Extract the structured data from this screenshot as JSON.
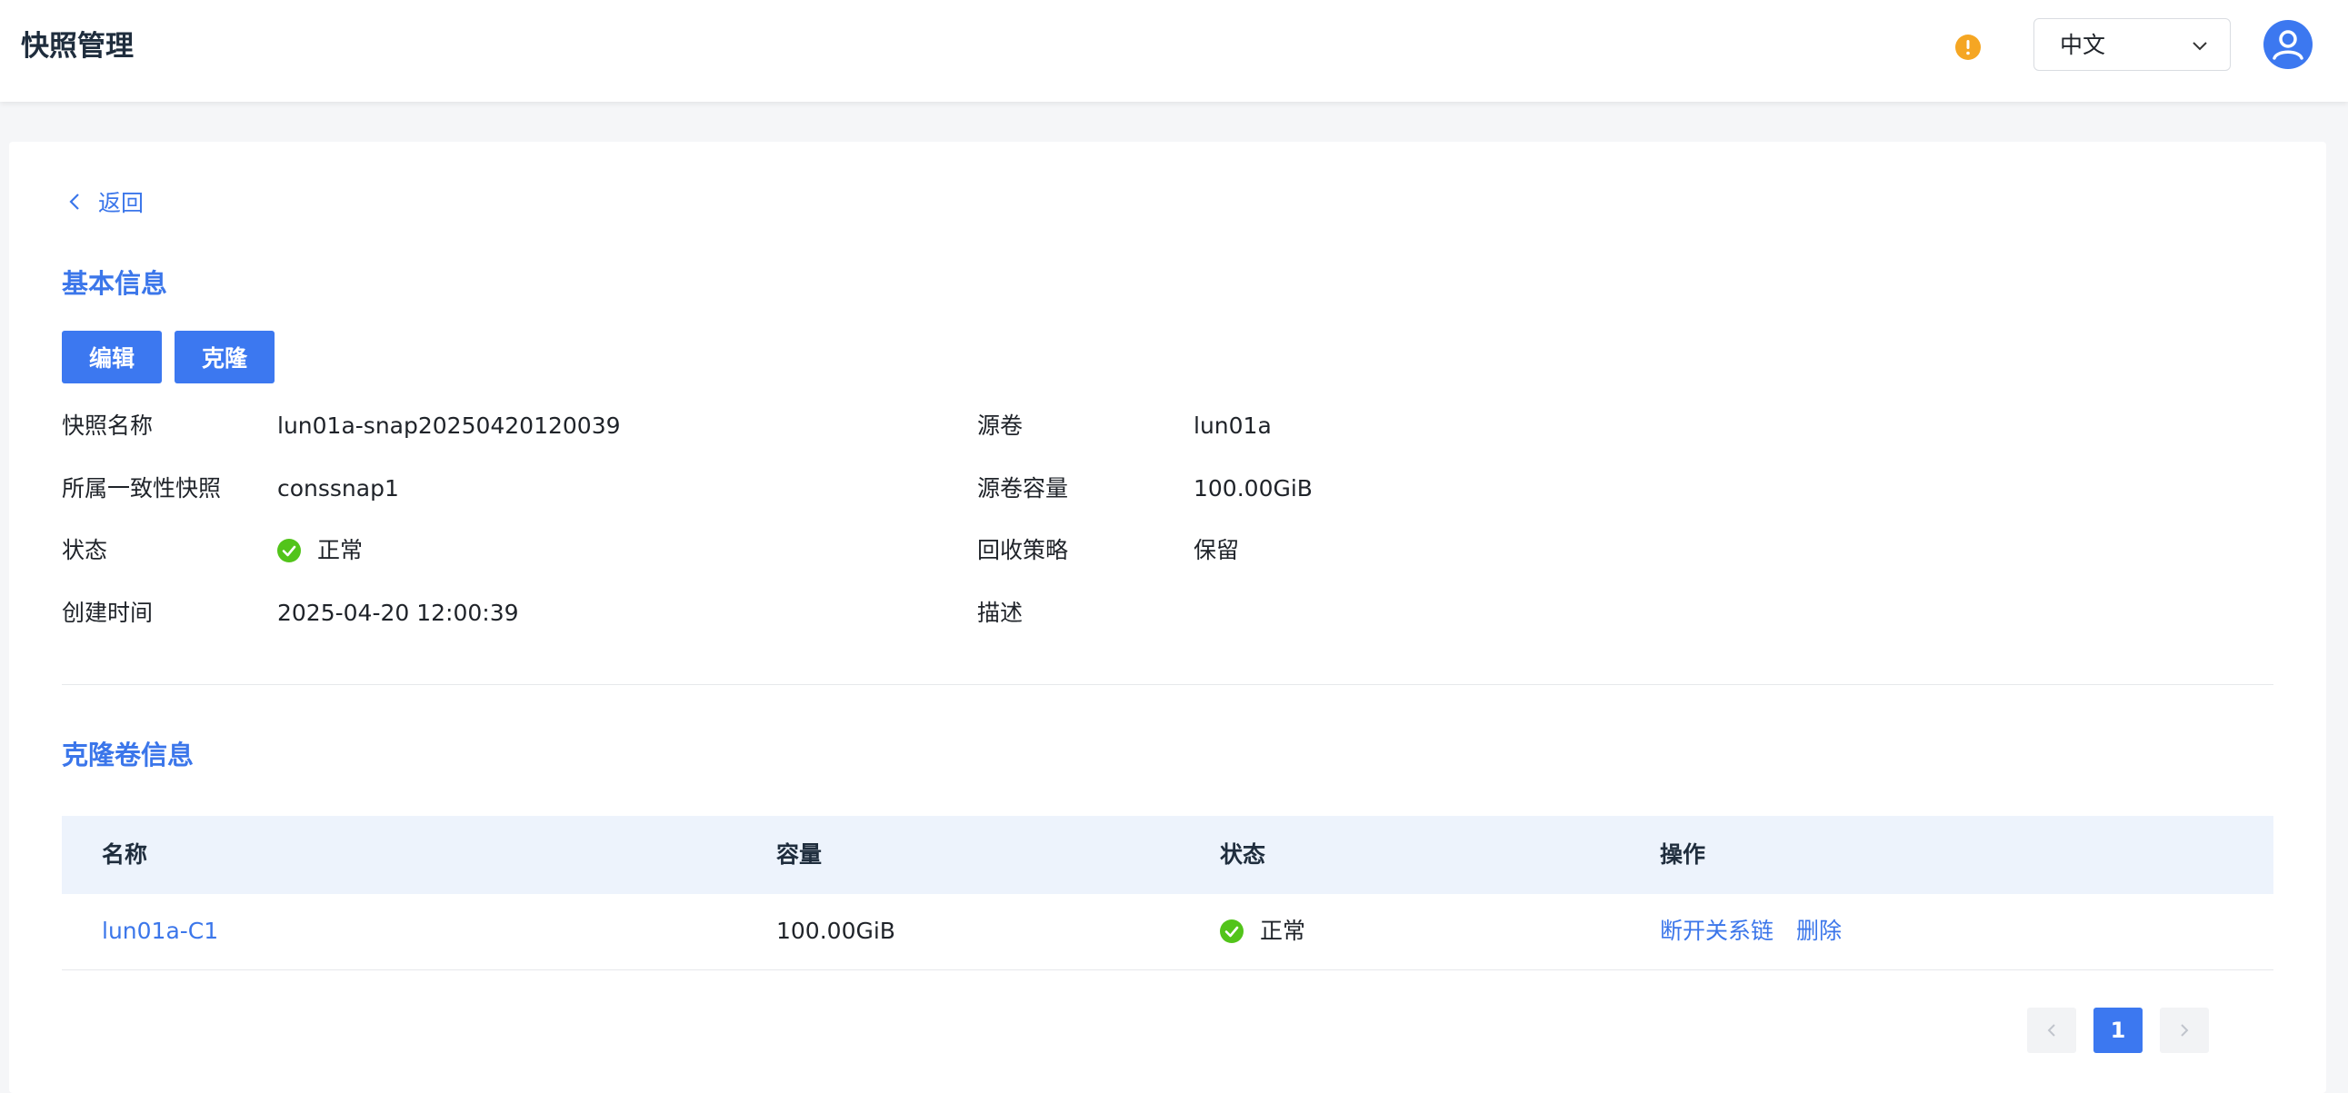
{
  "header": {
    "title": "快照管理",
    "language": "中文",
    "icons": {
      "warning": "warning-icon",
      "dropdown": "chevron-down-icon",
      "user": "user-avatar-icon"
    },
    "colors": {
      "warning": "#f5a623",
      "avatar": "#3c78f0"
    }
  },
  "back": {
    "label": "返回"
  },
  "basic_info": {
    "title": "基本信息",
    "edit_label": "编辑",
    "clone_label": "克隆",
    "fields": {
      "snapshot_name": {
        "label": "快照名称",
        "value": "lun01a-snap20250420120039"
      },
      "consistency_snapshot": {
        "label": "所属一致性快照",
        "value": "conssnap1"
      },
      "status": {
        "label": "状态",
        "value": "正常"
      },
      "created_at": {
        "label": "创建时间",
        "value": "2025-04-20 12:00:39"
      },
      "source_volume": {
        "label": "源卷",
        "value": "lun01a"
      },
      "source_capacity": {
        "label": "源卷容量",
        "value": "100.00GiB"
      },
      "recycle_policy": {
        "label": "回收策略",
        "value": "保留"
      },
      "description": {
        "label": "描述",
        "value": ""
      }
    }
  },
  "clone_info": {
    "title": "克隆卷信息",
    "columns": {
      "name": "名称",
      "capacity": "容量",
      "status": "状态",
      "actions": "操作"
    },
    "rows": [
      {
        "name": "lun01a-C1",
        "capacity": "100.00GiB",
        "status": "正常",
        "action_disconnect": "断开关系链",
        "action_delete": "删除"
      }
    ]
  },
  "pagination": {
    "current_page": "1"
  },
  "colors": {
    "accent": "#3c78f0",
    "link": "#3b76ea",
    "success": "#52c41a",
    "table_header_bg": "#edf3fc"
  }
}
